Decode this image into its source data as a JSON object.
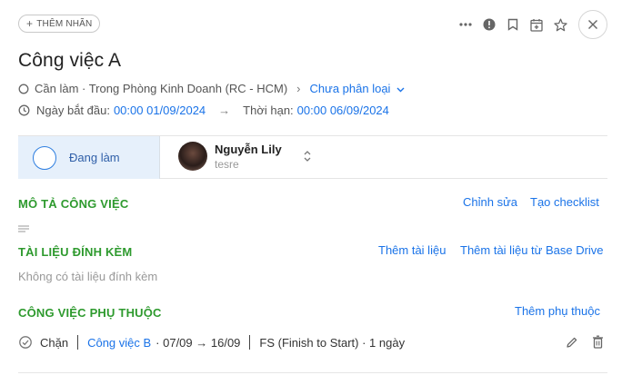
{
  "header": {
    "tag_button_label": "THÊM NHÃN",
    "icons": [
      "more-icon",
      "info-icon",
      "bookmark-icon",
      "calendar-add-icon",
      "star-icon",
      "close-icon"
    ]
  },
  "task": {
    "title": "Công việc A",
    "status_path": "Cần làm · Trong Phòng Kinh Doanh (RC - HCM)",
    "category": "Chưa phân loại",
    "start_label": "Ngày bắt đầu:",
    "start_value": "00:00 01/09/2024",
    "deadline_label": "Thời hạn:",
    "deadline_value": "00:00 06/09/2024"
  },
  "status": {
    "label": "Đang làm",
    "assignee_name": "Nguyễn Lily",
    "assignee_sub": "tesre"
  },
  "description": {
    "title": "MÔ TẢ CÔNG VIỆC",
    "edit_label": "Chỉnh sửa",
    "checklist_label": "Tạo checklist"
  },
  "attachments": {
    "title": "TÀI LIỆU ĐÍNH KÈM",
    "add_label": "Thêm tài liệu",
    "add_drive_label": "Thêm tài liệu từ Base Drive",
    "empty_text": "Không có tài liệu đính kèm"
  },
  "dependencies": {
    "title": "CÔNG VIỆC PHỤ THUỘC",
    "add_label": "Thêm phụ thuộc",
    "items": [
      {
        "type": "Chặn",
        "task": "Công việc B",
        "date_range": "· 07/09 → 16/09",
        "relation": "FS (Finish to Start) · 1 ngày"
      }
    ]
  },
  "colors": {
    "accent": "#1a73e8",
    "section": "#2e9a2e",
    "status_bg": "#e6f0fb"
  }
}
